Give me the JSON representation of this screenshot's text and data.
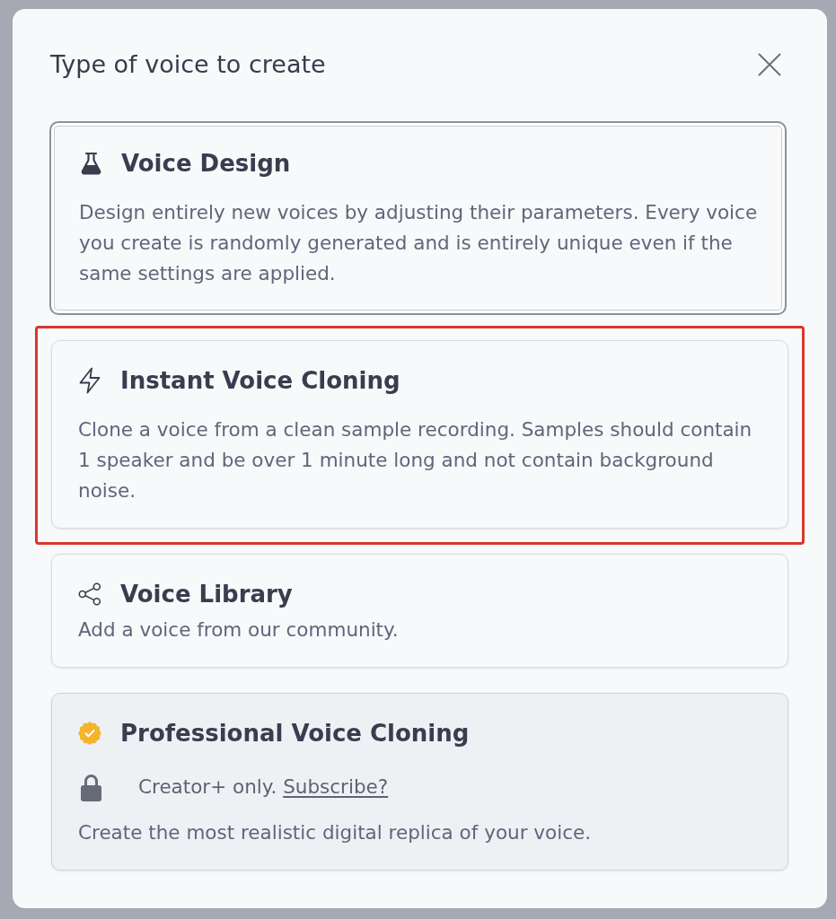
{
  "dialog": {
    "title": "Type of voice to create"
  },
  "options": [
    {
      "kind": "design",
      "title": "Voice Design",
      "description": "Design entirely new voices by adjusting their parameters. Every voice you create is randomly generated and is entirely unique even if the same settings are applied.",
      "selected": true,
      "highlighted": false,
      "locked": false
    },
    {
      "kind": "instant",
      "title": "Instant Voice Cloning",
      "description": "Clone a voice from a clean sample recording. Samples should contain 1 speaker and be over 1 minute long and not contain background noise.",
      "selected": false,
      "highlighted": true,
      "locked": false
    },
    {
      "kind": "library",
      "title": "Voice Library",
      "description": "Add a voice from our community.",
      "selected": false,
      "highlighted": false,
      "locked": false
    },
    {
      "kind": "professional",
      "title": "Professional Voice Cloning",
      "requirement": {
        "note": "Creator+ only.",
        "link": "Subscribe?"
      },
      "description": "Create the most realistic digital replica of your voice.",
      "selected": false,
      "highlighted": false,
      "locked": true
    }
  ]
}
